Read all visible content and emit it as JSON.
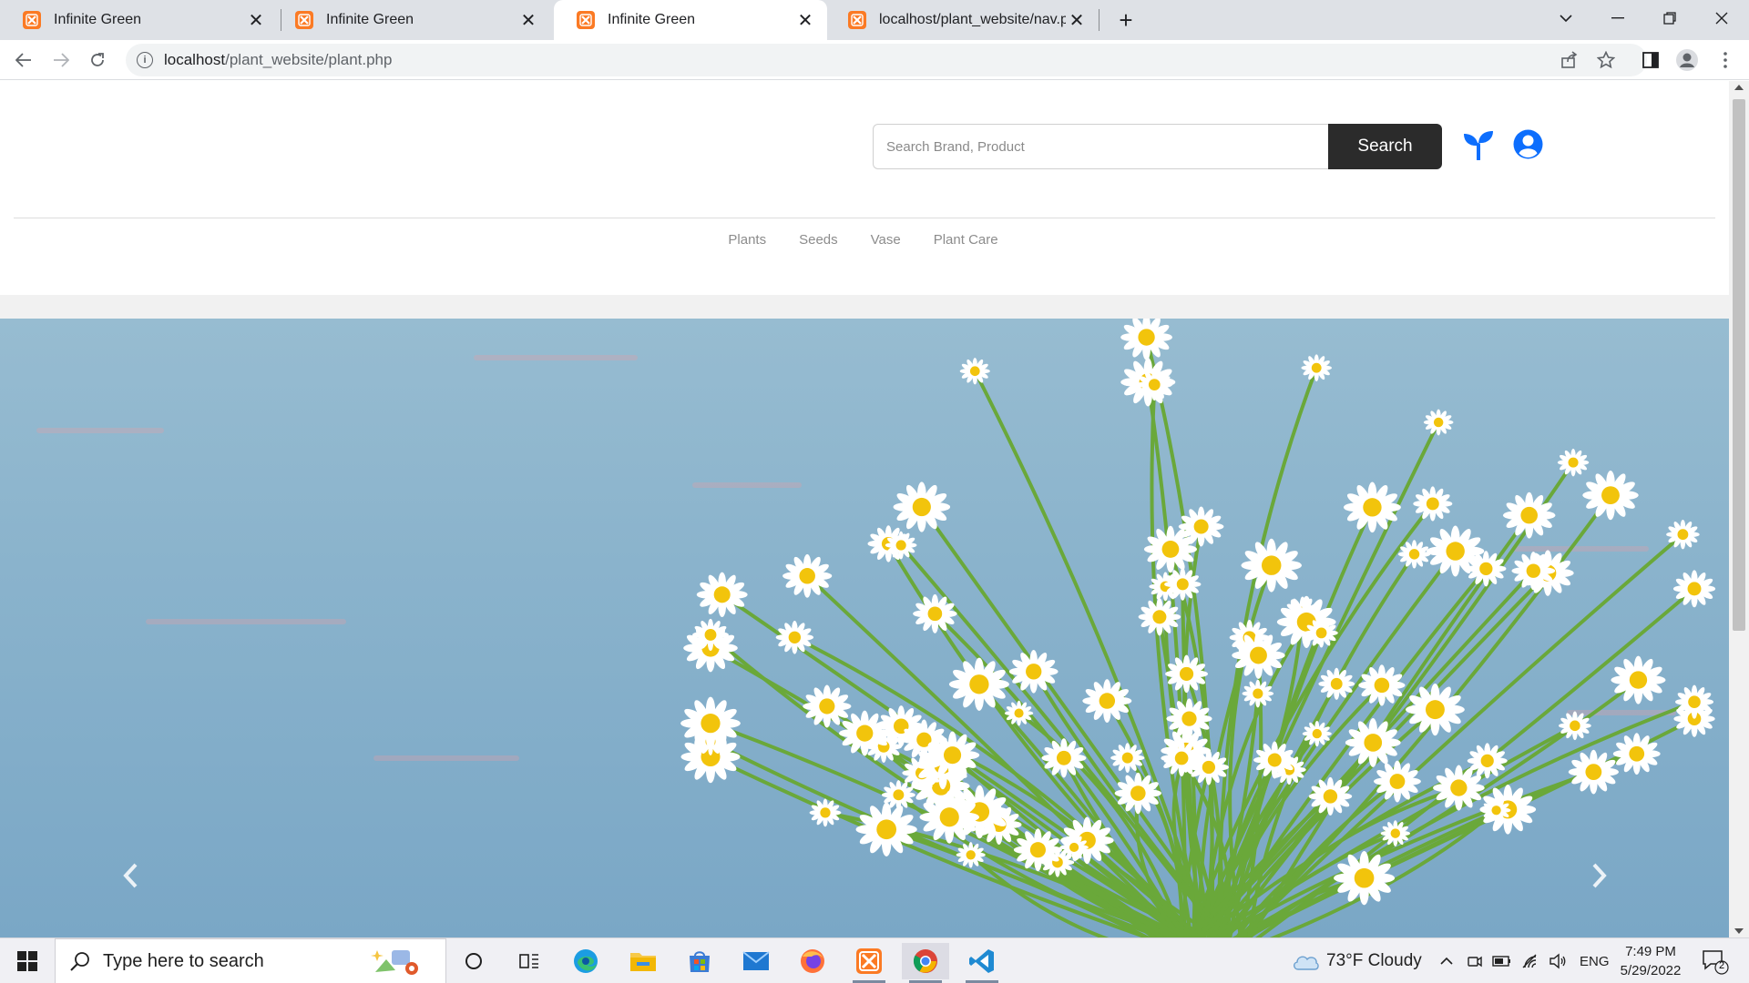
{
  "browser": {
    "tabs": [
      {
        "title": "Infinite Green",
        "active": false
      },
      {
        "title": "Infinite Green",
        "active": false
      },
      {
        "title": "Infinite Green",
        "active": true
      },
      {
        "title": "localhost/plant_website/nav.php",
        "active": false
      }
    ],
    "url_host": "localhost",
    "url_path": "/plant_website/plant.php"
  },
  "site": {
    "search_placeholder": "Search Brand, Product",
    "search_button": "Search",
    "nav": [
      "Plants",
      "Seeds",
      "Vase",
      "Plant Care"
    ],
    "accent_color": "#0d6efd"
  },
  "taskbar": {
    "search_placeholder": "Type here to search",
    "weather": "73°F  Cloudy",
    "language": "ENG",
    "time": "7:49 PM",
    "date": "5/29/2022",
    "notification_count": "2"
  }
}
